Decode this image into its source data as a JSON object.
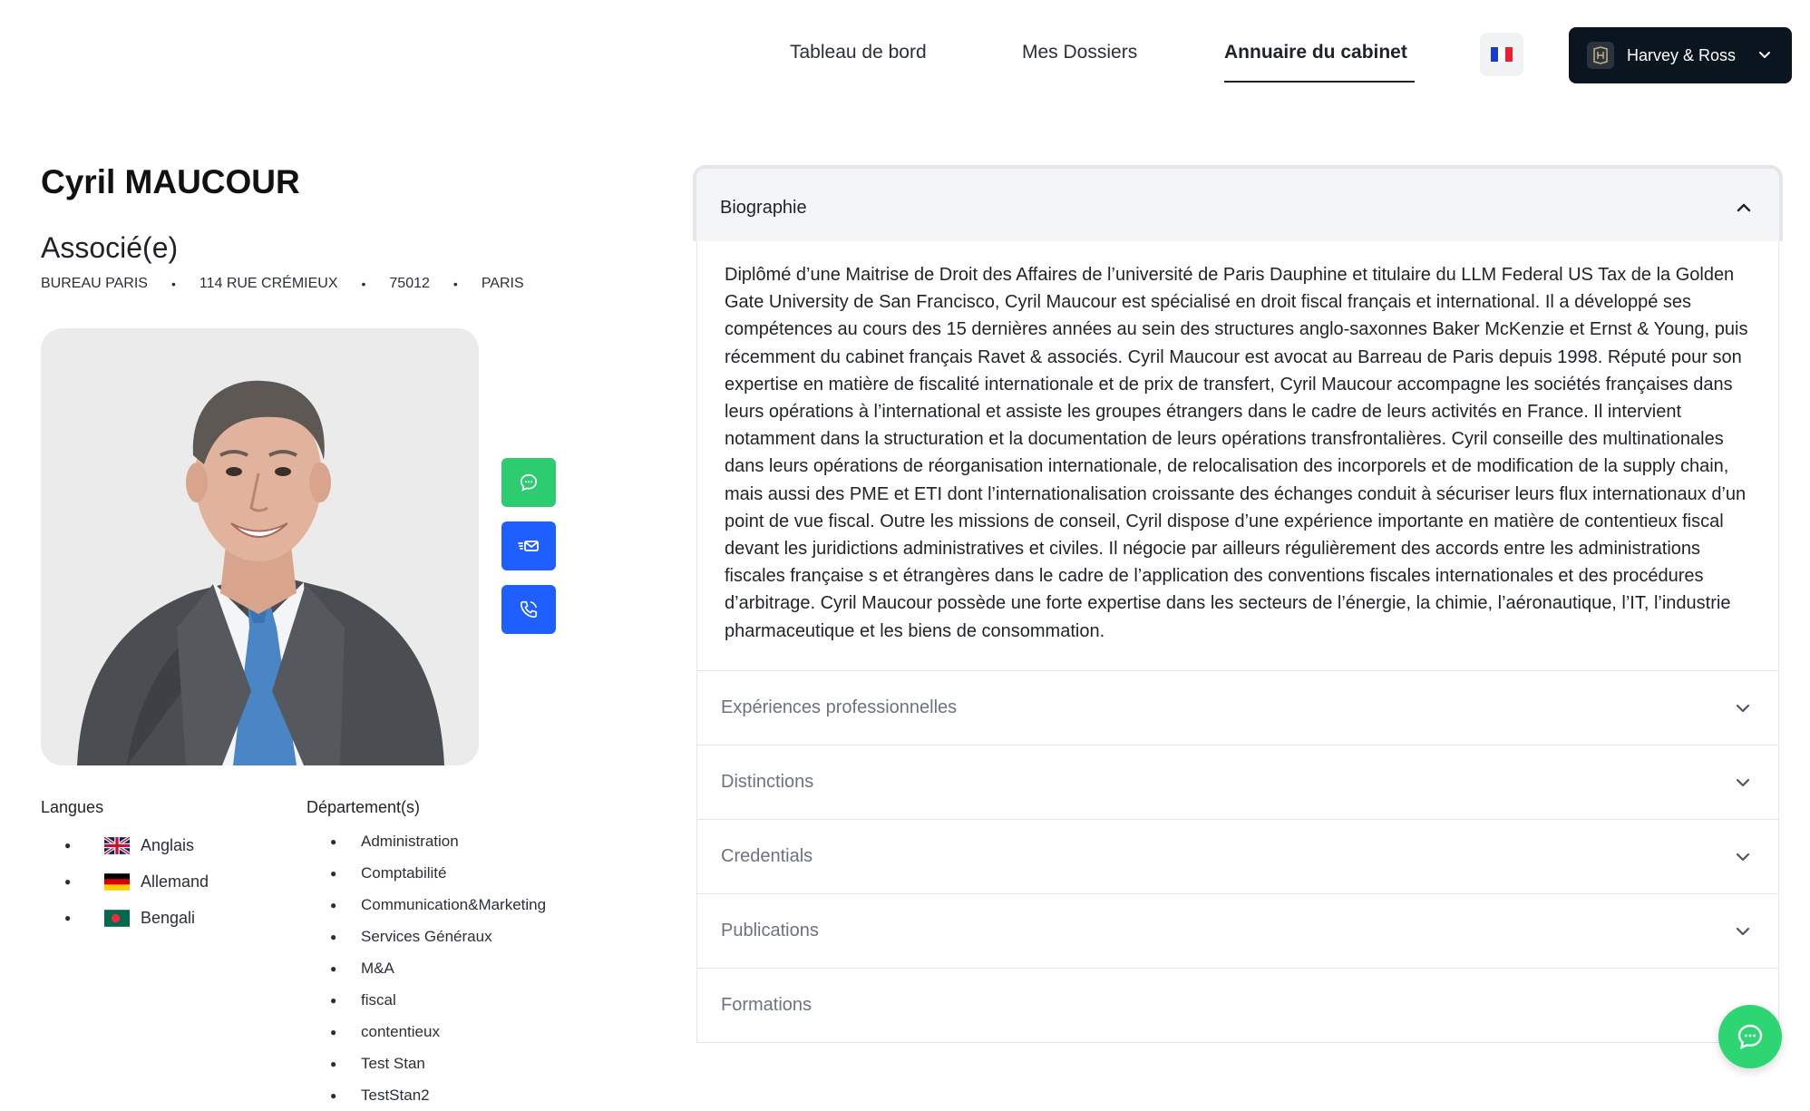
{
  "nav": {
    "links": [
      "Tableau de bord",
      "Mes Dossiers",
      "Annuaire du cabinet"
    ],
    "active": "Annuaire du cabinet",
    "language_icon": "france-flag-icon",
    "firm_name": "Harvey & Ross"
  },
  "profile": {
    "name": "Cyril MAUCOUR",
    "role": "Associé(e)",
    "address": [
      "BUREAU PARIS",
      "114 RUE CRÉMIEUX",
      "75012",
      "PARIS"
    ],
    "address_separator": "•",
    "photo_alt": "photo"
  },
  "actions": {
    "chat_icon": "chat-bubble-icon",
    "email_icon": "email-icon",
    "phone_icon": "phone-icon",
    "colors": {
      "chat": "#2ecc71",
      "email": "#1f5eff",
      "phone": "#1f5eff"
    }
  },
  "languages": {
    "title": "Langues",
    "items": [
      {
        "label": "Anglais",
        "flag": "uk-flag-icon"
      },
      {
        "label": "Allemand",
        "flag": "germany-flag-icon"
      },
      {
        "label": "Bengali",
        "flag": "bangladesh-flag-icon"
      }
    ]
  },
  "departments": {
    "title": "Département(s)",
    "items": [
      "Administration",
      "Comptabilité",
      "Communication&Marketing",
      "Services Généraux",
      "M&A",
      "fiscal",
      "contentieux",
      "Test Stan",
      "TestStan2"
    ]
  },
  "accordion": {
    "open_title": "Biographie",
    "biography": "Diplômé d’une Maitrise de Droit des Affaires de l’université de Paris Dauphine et titulaire du LLM Federal US Tax de la Golden Gate University de San Francisco, Cyril Maucour est spécialisé en droit fiscal français et international. Il a développé ses compétences au cours des 15 dernières années au sein des structures anglo-saxonnes Baker McKenzie et Ernst & Young, puis récemment du cabinet français Ravet & associés. Cyril Maucour est avocat au Barreau de Paris depuis 1998. Réputé pour son expertise en matière de fiscalité internationale et de prix de transfert, Cyril Maucour accompagne les sociétés françaises dans leurs opérations à l’international et assiste les groupes étrangers dans le cadre de leurs activités en France. Il intervient notamment dans la structuration et la documentation de leurs opérations transfrontalières. Cyril conseille des multinationales dans leurs opérations de réorganisation internationale, de relocalisation des incorporels et de modification de la supply chain, mais aussi des PME et ETI dont l’internationalisation croissante des échanges conduit à sécuriser leurs flux internationaux d’un point de vue fiscal. Outre les missions de conseil, Cyril dispose d’une expérience importante en matière de contentieux fiscal devant les juridictions administratives et civiles. Il négocie par ailleurs régulièrement des accords entre les administrations fiscales française s et étrangères dans le cadre de l’application des conventions fiscales internationales et des procédures d’arbitrage. Cyril Maucour possède une forte expertise dans les secteurs de l’énergie, la chimie, l’aéronautique, l’IT, l’industrie pharmaceutique et les biens de consommation.",
    "collapsed": [
      "Expériences professionnelles",
      "Distinctions",
      "Credentials",
      "Publications",
      "Formations"
    ]
  },
  "floating": {
    "icon": "chat-bubble-icon"
  }
}
